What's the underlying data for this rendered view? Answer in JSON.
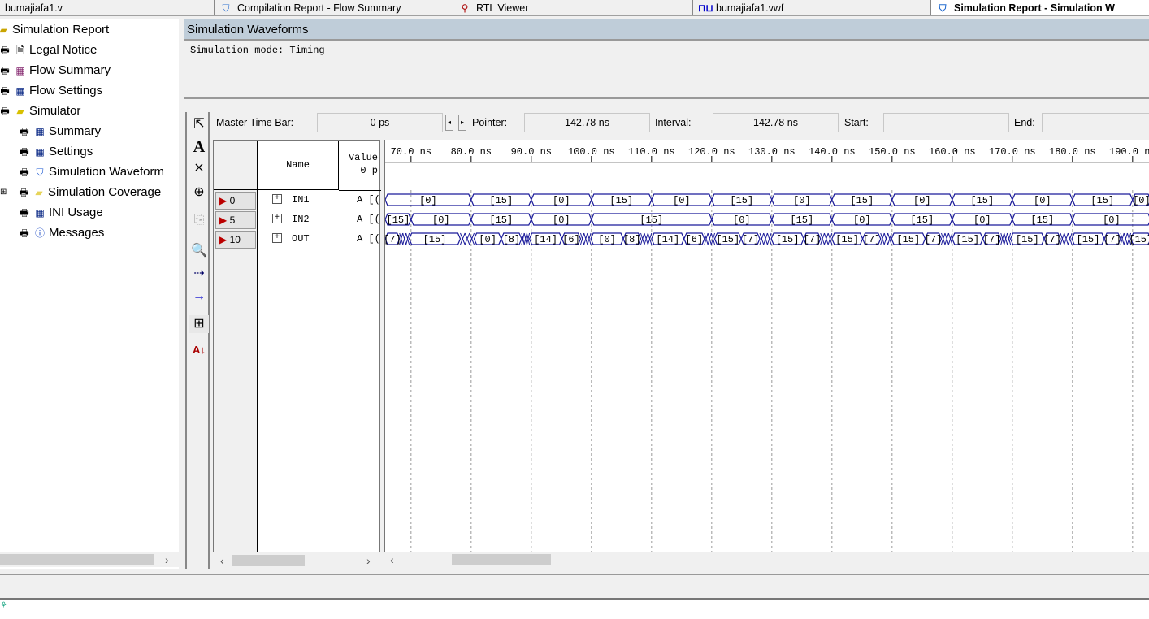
{
  "tabs": [
    {
      "label": "bumajiafa1.v",
      "icon": "verilog-file-icon"
    },
    {
      "label": "Compilation Report - Flow Summary",
      "icon": "report-icon"
    },
    {
      "label": "RTL Viewer",
      "icon": "rtl-viewer-icon"
    },
    {
      "label": "bumajiafa1.vwf",
      "icon": "waveform-file-icon"
    },
    {
      "label": "Simulation Report - Simulation W",
      "icon": "report-icon",
      "active": true
    }
  ],
  "tree": [
    {
      "label": "Simulation Report",
      "icon": "folder-icon"
    },
    {
      "label": "Legal Notice",
      "icon": "document-icon"
    },
    {
      "label": "Flow Summary",
      "icon": "table-icon"
    },
    {
      "label": "Flow Settings",
      "icon": "table-icon"
    },
    {
      "label": "Simulator",
      "icon": "folder-icon"
    },
    {
      "label": "Summary",
      "icon": "table-icon"
    },
    {
      "label": "Settings",
      "icon": "table-icon"
    },
    {
      "label": "Simulation Waveform",
      "icon": "waveform-icon"
    },
    {
      "label": "Simulation Coverage",
      "icon": "folder-icon"
    },
    {
      "label": "INI Usage",
      "icon": "table-icon"
    },
    {
      "label": "Messages",
      "icon": "info-icon"
    }
  ],
  "header": {
    "title": "Simulation Waveforms",
    "mode": "Simulation mode: Timing"
  },
  "timebar": {
    "master_label": "Master Time Bar:",
    "master_value": "0 ps",
    "pointer_label": "Pointer:",
    "pointer_value": "142.78 ns",
    "interval_label": "Interval:",
    "interval_value": "142.78 ns",
    "start_label": "Start:",
    "start_value": "",
    "end_label": "End:",
    "end_value": ""
  },
  "table": {
    "name_header": "Name",
    "value_header": "Value",
    "value_sub": "0 p",
    "rows": [
      {
        "index": "0",
        "name": "IN1",
        "value": "A [("
      },
      {
        "index": "5",
        "name": "IN2",
        "value": "A [("
      },
      {
        "index": "10",
        "name": "OUT",
        "value": "A [("
      }
    ]
  },
  "chart_data": {
    "type": "waveform",
    "time_unit": "ns",
    "visible_range": [
      65.7,
      193
    ],
    "ticks": [
      "70.0 ns",
      "80.0 ns",
      "90.0 ns",
      "100.0 ns",
      "110.0 ns",
      "120.0 ns",
      "130.0 ns",
      "140.0 ns",
      "150.0 ns",
      "160.0 ns",
      "170.0 ns",
      "180.0 ns",
      "190.0 ns"
    ],
    "tick_values": [
      70,
      80,
      90,
      100,
      110,
      120,
      130,
      140,
      150,
      160,
      170,
      180,
      190
    ],
    "grid": true,
    "color": "#1a1a9a",
    "signals": [
      {
        "name": "IN1",
        "segments": [
          [
            65.7,
            80,
            "[0]"
          ],
          [
            80,
            90,
            "[15]"
          ],
          [
            90,
            100,
            "[0]"
          ],
          [
            100,
            110,
            "[15]"
          ],
          [
            110,
            120,
            "[0]"
          ],
          [
            120,
            130,
            "[15]"
          ],
          [
            130,
            140,
            "[0]"
          ],
          [
            140,
            150,
            "[15]"
          ],
          [
            150,
            160,
            "[0]"
          ],
          [
            160,
            170,
            "[15]"
          ],
          [
            170,
            180,
            "[0]"
          ],
          [
            180,
            190,
            "[15]"
          ],
          [
            190,
            193,
            "[0]"
          ]
        ]
      },
      {
        "name": "IN2",
        "segments": [
          [
            65.7,
            70,
            "[15]"
          ],
          [
            70,
            80,
            "[0]"
          ],
          [
            80,
            90,
            "[15]"
          ],
          [
            90,
            100,
            "[0]"
          ],
          [
            100,
            120,
            "[15]"
          ],
          [
            120,
            130,
            "[0]"
          ],
          [
            130,
            140,
            "[15]"
          ],
          [
            140,
            150,
            "[0]"
          ],
          [
            150,
            160,
            "[15]"
          ],
          [
            160,
            170,
            "[0]"
          ],
          [
            170,
            180,
            "[15]"
          ],
          [
            180,
            193,
            "[0]"
          ]
        ]
      },
      {
        "name": "OUT",
        "segments": [
          [
            65.7,
            68.1,
            "[7]"
          ],
          [
            68.1,
            69.7,
            "X"
          ],
          [
            69.7,
            78.2,
            "[15]"
          ],
          [
            78.2,
            80.5,
            "X"
          ],
          [
            80.5,
            85.0,
            "[0]"
          ],
          [
            85.0,
            88.4,
            "[8]"
          ],
          [
            88.4,
            89.7,
            "X"
          ],
          [
            89.7,
            95.1,
            "[14]"
          ],
          [
            95.1,
            98.2,
            "[6]"
          ],
          [
            98.2,
            99.9,
            "X"
          ],
          [
            99.9,
            105.3,
            "[0]"
          ],
          [
            105.3,
            108.2,
            "[8]"
          ],
          [
            108.2,
            110.0,
            "X"
          ],
          [
            110.0,
            115.4,
            "[14]"
          ],
          [
            115.4,
            118.8,
            "[6]"
          ],
          [
            118.8,
            120.5,
            "X"
          ],
          [
            120.5,
            124.9,
            "[15]"
          ],
          [
            124.9,
            128.0,
            "[7]"
          ],
          [
            128.0,
            129.9,
            "X"
          ],
          [
            129.9,
            135.3,
            "[15]"
          ],
          [
            135.3,
            138.1,
            "[7]"
          ],
          [
            138.1,
            140.0,
            "X"
          ],
          [
            140.0,
            145.1,
            "[15]"
          ],
          [
            145.1,
            148.1,
            "[7]"
          ],
          [
            148.1,
            149.9,
            "X"
          ],
          [
            149.9,
            155.5,
            "[15]"
          ],
          [
            155.5,
            158.2,
            "[7]"
          ],
          [
            158.2,
            160.0,
            "X"
          ],
          [
            160.0,
            165.1,
            "[15]"
          ],
          [
            165.1,
            168.1,
            "[7]"
          ],
          [
            168.1,
            169.7,
            "X"
          ],
          [
            169.7,
            175.3,
            "[15]"
          ],
          [
            175.3,
            178.0,
            "[7]"
          ],
          [
            178.0,
            179.9,
            "X"
          ],
          [
            179.9,
            185.3,
            "[15]"
          ],
          [
            185.3,
            188.0,
            "[7]"
          ],
          [
            188.0,
            189.7,
            "X"
          ],
          [
            189.7,
            193,
            "[15]"
          ]
        ]
      }
    ]
  }
}
